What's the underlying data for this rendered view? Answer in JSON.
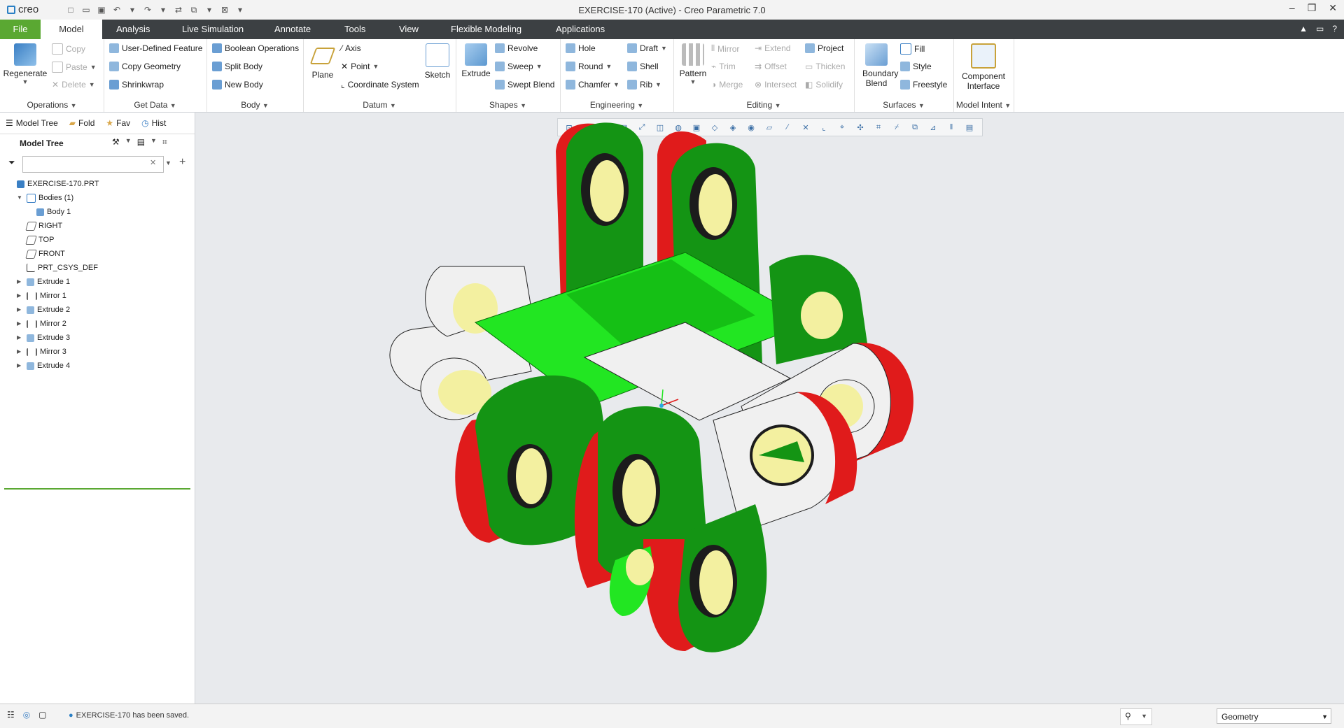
{
  "window": {
    "title": "EXERCISE-170 (Active) - Creo Parametric 7.0",
    "logo": "creo"
  },
  "tabs": [
    "File",
    "Model",
    "Analysis",
    "Live Simulation",
    "Annotate",
    "Tools",
    "View",
    "Flexible Modeling",
    "Applications"
  ],
  "ribbon": {
    "operations": {
      "label": "Operations",
      "regenerate": "Regenerate",
      "copy": "Copy",
      "paste": "Paste",
      "delete": "Delete"
    },
    "getdata": {
      "label": "Get Data",
      "udf": "User-Defined Feature",
      "copygeom": "Copy Geometry",
      "shrinkwrap": "Shrinkwrap"
    },
    "body": {
      "label": "Body",
      "boolean": "Boolean Operations",
      "split": "Split Body",
      "new": "New Body"
    },
    "datum": {
      "label": "Datum",
      "plane": "Plane",
      "axis": "Axis",
      "point": "Point",
      "csys": "Coordinate System",
      "sketch": "Sketch"
    },
    "shapes": {
      "label": "Shapes",
      "extrude": "Extrude",
      "revolve": "Revolve",
      "sweep": "Sweep",
      "sweptblend": "Swept Blend"
    },
    "engineering": {
      "label": "Engineering",
      "hole": "Hole",
      "round": "Round",
      "chamfer": "Chamfer",
      "draft": "Draft",
      "shell": "Shell",
      "rib": "Rib"
    },
    "editing": {
      "label": "Editing",
      "pattern": "Pattern",
      "mirror": "Mirror",
      "trim": "Trim",
      "merge": "Merge",
      "extend": "Extend",
      "offset": "Offset",
      "intersect": "Intersect",
      "project": "Project",
      "thicken": "Thicken",
      "solidify": "Solidify"
    },
    "surfaces": {
      "label": "Surfaces",
      "boundary": "Boundary Blend",
      "fill": "Fill",
      "style": "Style",
      "freestyle": "Freestyle"
    },
    "modelintent": {
      "label": "Model Intent",
      "component": "Component Interface"
    }
  },
  "panel": {
    "tabs": [
      "Model Tree",
      "Fold",
      "Fav",
      "Hist"
    ],
    "title": "Model Tree",
    "search_placeholder": "",
    "tree": [
      {
        "label": "EXERCISE-170.PRT",
        "indent": 0,
        "twisty": "",
        "icon": "part-icon"
      },
      {
        "label": "Bodies (1)",
        "indent": 1,
        "twisty": "▼",
        "icon": "bodies-icon"
      },
      {
        "label": "Body 1",
        "indent": 2,
        "twisty": "",
        "icon": "body-icon"
      },
      {
        "label": "RIGHT",
        "indent": 1,
        "twisty": "",
        "icon": "plane-icon"
      },
      {
        "label": "TOP",
        "indent": 1,
        "twisty": "",
        "icon": "plane-icon"
      },
      {
        "label": "FRONT",
        "indent": 1,
        "twisty": "",
        "icon": "plane-icon"
      },
      {
        "label": "PRT_CSYS_DEF",
        "indent": 1,
        "twisty": "",
        "icon": "csys-icon"
      },
      {
        "label": "Extrude 1",
        "indent": 1,
        "twisty": "▶",
        "icon": "extrude-icon"
      },
      {
        "label": "Mirror 1",
        "indent": 1,
        "twisty": "▶",
        "icon": "mirror-icon"
      },
      {
        "label": "Extrude 2",
        "indent": 1,
        "twisty": "▶",
        "icon": "extrude-icon"
      },
      {
        "label": "Mirror 2",
        "indent": 1,
        "twisty": "▶",
        "icon": "mirror-icon"
      },
      {
        "label": "Extrude 3",
        "indent": 1,
        "twisty": "▶",
        "icon": "extrude-icon"
      },
      {
        "label": "Mirror 3",
        "indent": 1,
        "twisty": "▶",
        "icon": "mirror-icon"
      },
      {
        "label": "Extrude 4",
        "indent": 1,
        "twisty": "▶",
        "icon": "extrude-icon"
      }
    ]
  },
  "status": {
    "message": "EXERCISE-170 has been saved.",
    "filter": "Geometry"
  },
  "colors": {
    "file_tab": "#5aa832",
    "tab_bar": "#3c4043",
    "green_dark": "#149414",
    "green_light": "#22e622",
    "red": "#e01b1b",
    "hole": "#f3f0a0",
    "white_face": "#f0f0f0"
  }
}
